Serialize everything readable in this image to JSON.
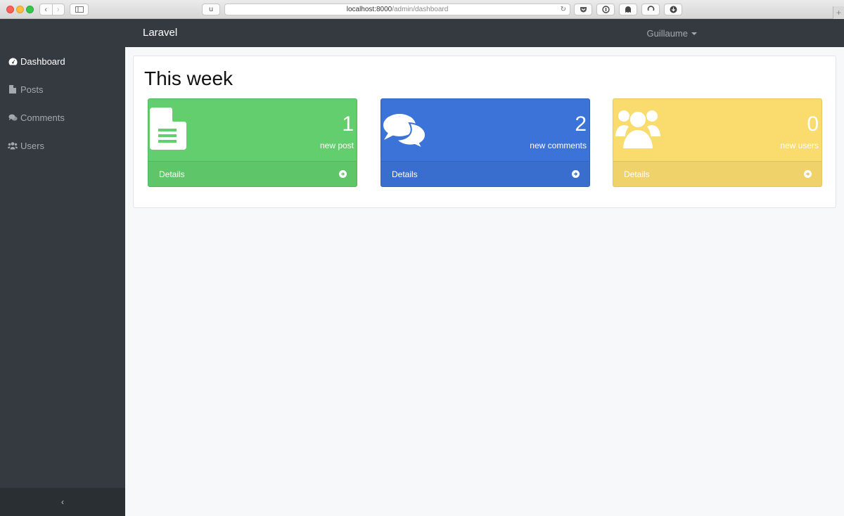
{
  "browser": {
    "url_host": "localhost:8000",
    "url_path": "/admin/dashboard",
    "ext_button_label": "u"
  },
  "navbar": {
    "brand": "Laravel",
    "user": "Guillaume"
  },
  "sidebar": {
    "items": [
      {
        "label": "Dashboard",
        "icon": "dashboard-icon",
        "active": true
      },
      {
        "label": "Posts",
        "icon": "file-icon",
        "active": false
      },
      {
        "label": "Comments",
        "icon": "comments-icon",
        "active": false
      },
      {
        "label": "Users",
        "icon": "users-icon",
        "active": false
      }
    ],
    "collapse_glyph": "‹"
  },
  "main": {
    "title": "This week",
    "cards": [
      {
        "count": "1",
        "label": "new post",
        "footer": "Details",
        "color": "#63ce6e",
        "icon": "file-icon"
      },
      {
        "count": "2",
        "label": "new comments",
        "footer": "Details",
        "color": "#3c73d8",
        "icon": "comments-icon"
      },
      {
        "count": "0",
        "label": "new users",
        "footer": "Details",
        "color": "#f9db6e",
        "icon": "users-icon"
      }
    ]
  }
}
